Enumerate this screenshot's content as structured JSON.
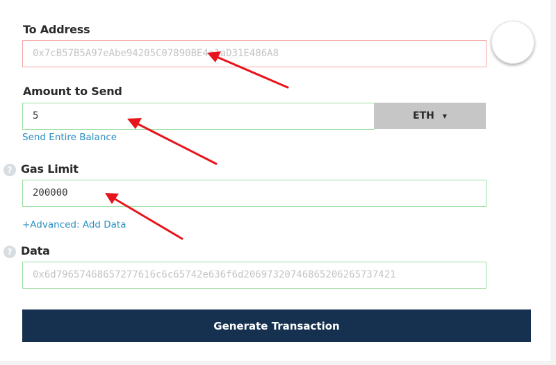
{
  "to_address": {
    "label": "To Address",
    "placeholder": "0x7cB57B5A97eAbe94205C07890BE4c1aD31E486A8"
  },
  "amount": {
    "label": "Amount to Send",
    "value": "5",
    "currency": "ETH",
    "send_entire_balance": "Send Entire Balance"
  },
  "gas_limit": {
    "help_icon": "?",
    "label": "Gas Limit",
    "value": "200000",
    "advanced_link": "+Advanced: Add Data"
  },
  "data_field": {
    "help_icon": "?",
    "label": "Data",
    "placeholder": "0x6d79657468657277616c6c65742e636f6d20697320746865206265737421"
  },
  "generate_button": "Generate Transaction",
  "colors": {
    "annotation_arrow": "#e8141b",
    "error_border": "#f5a5a5",
    "ok_border": "#98dea0",
    "link": "#2a8fc0",
    "button_bg": "#163150"
  }
}
